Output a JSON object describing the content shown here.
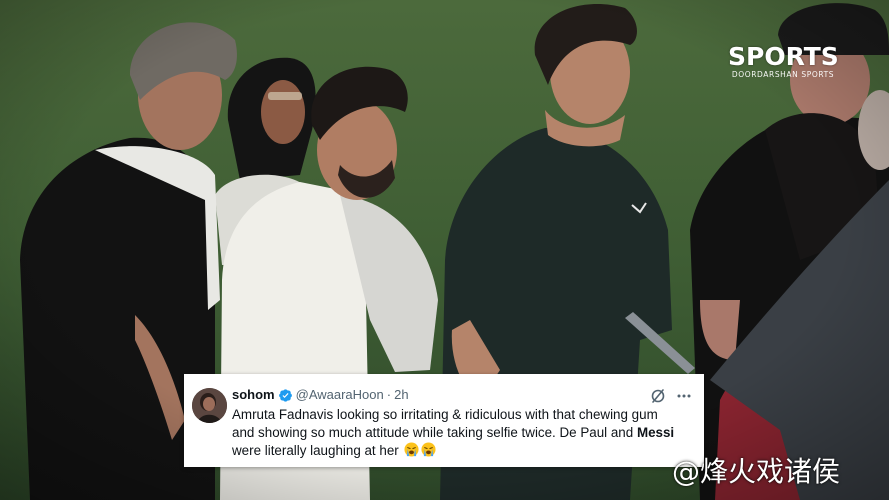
{
  "broadcaster": {
    "logo_main": "SPORTS",
    "logo_sub": "DOORDARSHAN SPORTS"
  },
  "tweet": {
    "name": "sohom",
    "handle": "@AwaaraHoon",
    "separator": "·",
    "time": "2h",
    "text_line1": "Amruta Fadnavis looking so irritating & ridiculous with that chewing gum",
    "text_line2": "and showing so much attitude while taking selfie twice. De Paul and ",
    "text_bold": "Messi",
    "text_line3": "were literally laughing at her",
    "verified_color": "#1d9bf0",
    "icons": [
      "verified-badge-icon",
      "grok-icon",
      "more-options-icon",
      "crying-face-emoji"
    ]
  },
  "watermark": {
    "text": "@烽火戏诸侯"
  },
  "colors": {
    "pitch": "#41603a",
    "tweet_background": "#ffffff",
    "tweet_text": "#0f1419",
    "tweet_secondary": "#536471"
  }
}
